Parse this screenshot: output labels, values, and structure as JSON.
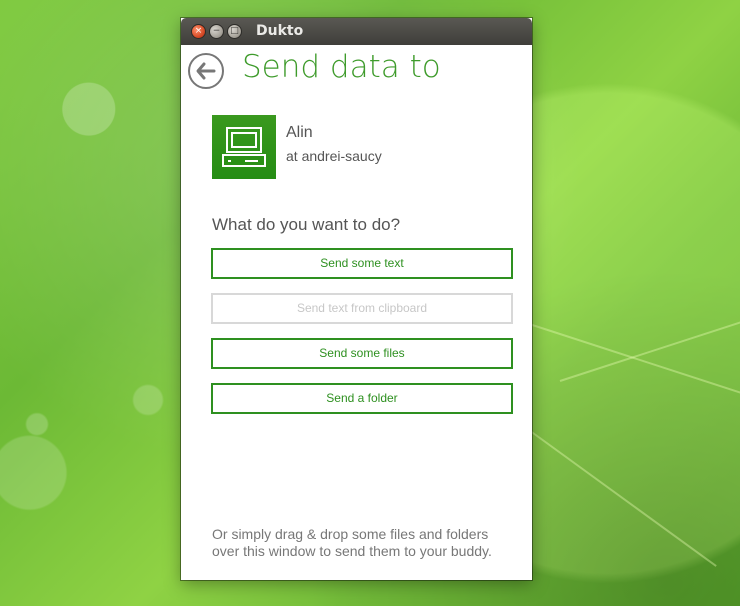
{
  "window": {
    "title": "Dukto"
  },
  "header": {
    "title": "Send data to"
  },
  "buddy": {
    "name": "Alin",
    "host": "at andrei-saucy"
  },
  "prompt": {
    "question": "What do you want to do?"
  },
  "actions": [
    {
      "label": "Send some text",
      "enabled": true
    },
    {
      "label": "Send text from clipboard",
      "enabled": false
    },
    {
      "label": "Send some files",
      "enabled": true
    },
    {
      "label": "Send a folder",
      "enabled": true
    }
  ],
  "footer": {
    "line1": "Or simply drag & drop some files and folders",
    "line2": "over this window to send them to your buddy."
  },
  "icons": {
    "back": "arrow-left-icon",
    "buddy": "computer-icon",
    "close": "close-icon",
    "minimize": "minimize-icon",
    "maximize": "maximize-icon"
  },
  "colors": {
    "accent": "#2e9020",
    "title": "#3e9b2b",
    "disabled_text": "#c7c7c7",
    "disabled_border": "#d8d8d8",
    "titlebar": "#4b4a46",
    "desktop_green": "#78c43c"
  }
}
